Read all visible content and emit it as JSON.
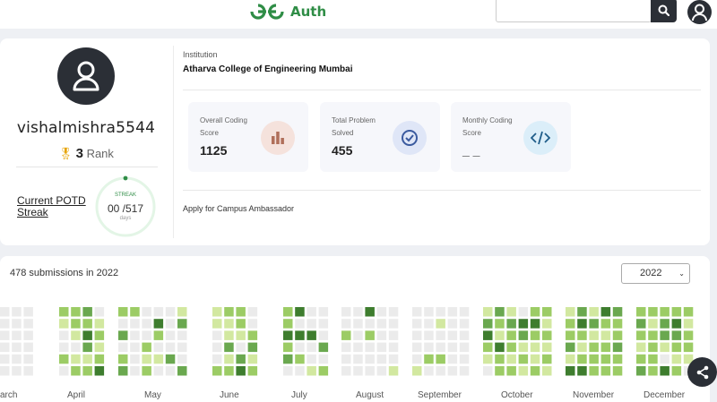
{
  "header": {
    "logo_text": "Auth",
    "search_placeholder": "",
    "icons": [
      "gfg-logo-icon",
      "search-icon",
      "user-icon"
    ]
  },
  "profile": {
    "username": "vishalmishra5544",
    "rank_value": "3",
    "rank_label": "Rank",
    "potd_label": "Current POTD Streak",
    "streak_label": "STREAK",
    "streak_value": "00 /517",
    "streak_unit": "days",
    "institution_label": "Institution",
    "institution_name": "Atharva College of Engineering Mumbai",
    "stats": [
      {
        "label": "Overall Coding Score",
        "value": "1125",
        "icon": "bar-chart-icon"
      },
      {
        "label": "Total Problem Solved",
        "value": "455",
        "icon": "check-circle-icon"
      },
      {
        "label": "Monthly Coding Score",
        "value": "_ _",
        "icon": "code-icon"
      }
    ],
    "ambassador_link": "Apply for Campus Ambassador"
  },
  "submissions": {
    "summary": "478 submissions in 2022",
    "selected_year": "2022",
    "months": [
      "arch",
      "April",
      "May",
      "June",
      "July",
      "August",
      "September",
      "October",
      "November",
      "December"
    ],
    "levels": {
      "empty": "#ebebeb",
      "l1": "#d2e8a0",
      "l2": "#9ccc65",
      "l3": "#6aa84f",
      "l4": "#3e7d2e"
    }
  },
  "colors": {
    "brand_green": "#2f8d46",
    "dark": "#2b2f36"
  }
}
